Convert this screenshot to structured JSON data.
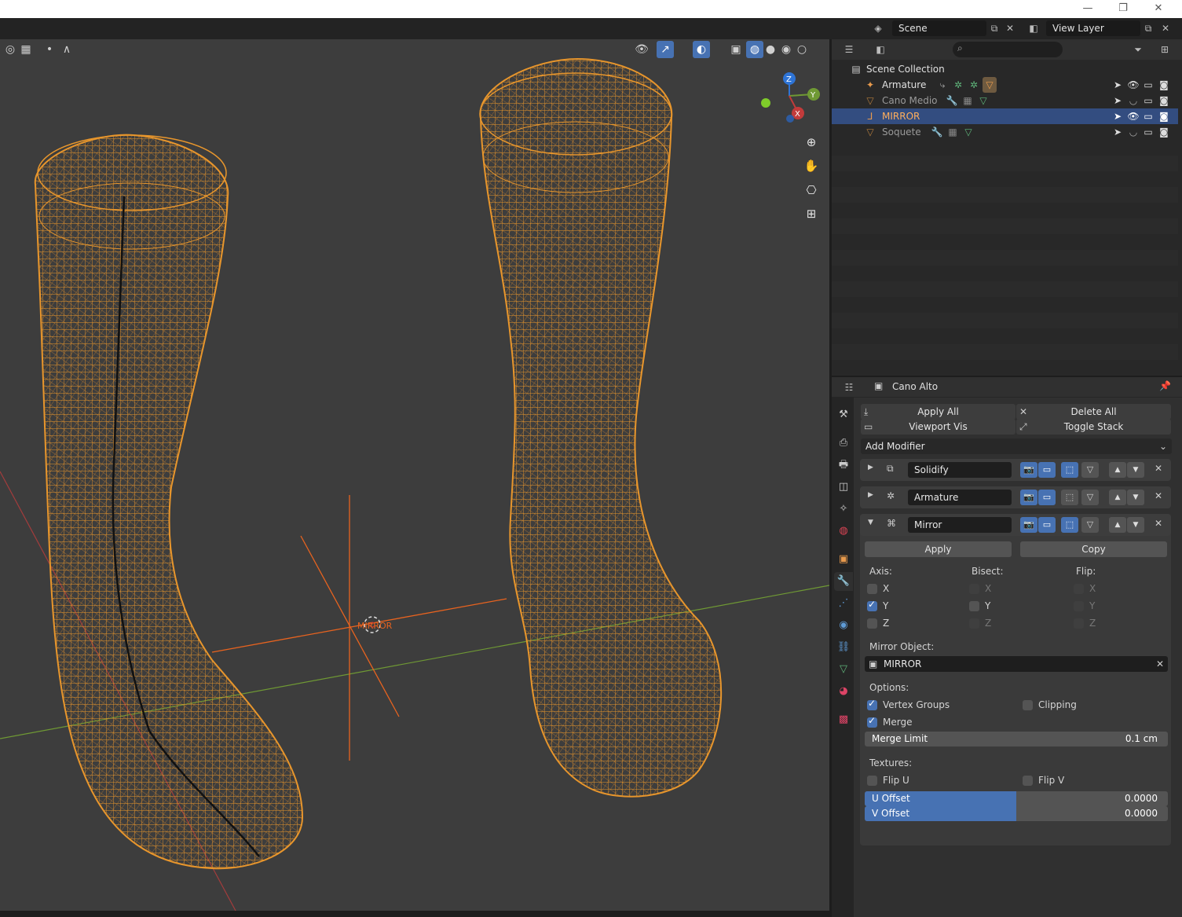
{
  "window": {
    "minimize": "—",
    "maximize": "❐",
    "close": "✕"
  },
  "topbar": {
    "scene": "Scene",
    "view_layer": "View Layer"
  },
  "viewport": {
    "object_label": "MIRROR",
    "gizmo": {
      "z": "Z",
      "y": "Y",
      "x": "X"
    },
    "colors": {
      "wire": "#e8962c",
      "bg": "#3d3d3d",
      "x_axis": "#a33c3c",
      "y_axis": "#6f9934"
    }
  },
  "outliner": {
    "root": "Scene Collection",
    "items": [
      {
        "name": "Armature",
        "selected": false
      },
      {
        "name": "Cano Medio",
        "selected": false
      },
      {
        "name": "MIRROR",
        "selected": true
      },
      {
        "name": "Soquete",
        "selected": false
      }
    ]
  },
  "properties": {
    "object_name": "Cano Alto",
    "apply_all": "Apply All",
    "delete_all": "Delete All",
    "viewport_vis": "Viewport Vis",
    "toggle_stack": "Toggle Stack",
    "add_modifier": "Add Modifier",
    "modifiers": [
      {
        "name": "Solidify",
        "expanded": false
      },
      {
        "name": "Armature",
        "expanded": false
      },
      {
        "name": "Mirror",
        "expanded": true
      }
    ],
    "mirror": {
      "apply": "Apply",
      "copy": "Copy",
      "axis_label": "Axis:",
      "bisect_label": "Bisect:",
      "flip_label": "Flip:",
      "x": "X",
      "y": "Y",
      "z": "Z",
      "mirror_object_label": "Mirror Object:",
      "mirror_object": "MIRROR",
      "options_label": "Options:",
      "vertex_groups": "Vertex Groups",
      "clipping": "Clipping",
      "merge": "Merge",
      "merge_limit_label": "Merge Limit",
      "merge_limit_value": "0.1 cm",
      "textures_label": "Textures:",
      "flip_u": "Flip U",
      "flip_v": "Flip V",
      "u_offset_label": "U Offset",
      "u_offset_value": "0.0000",
      "v_offset_label": "V Offset",
      "v_offset_value": "0.0000"
    }
  }
}
